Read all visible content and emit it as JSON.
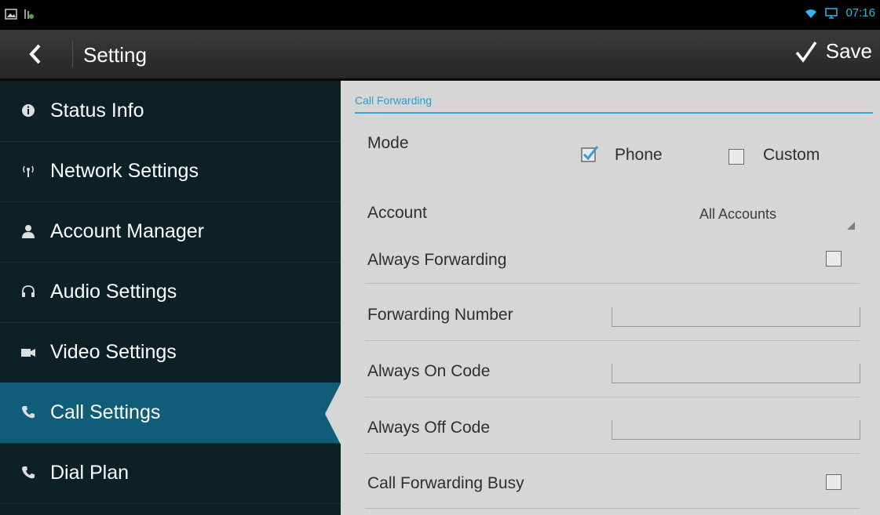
{
  "status_bar": {
    "time": "07:16",
    "left_icons": [
      "image-icon",
      "usb-icon"
    ],
    "right_icons": [
      "wifi-icon",
      "monitor-icon"
    ]
  },
  "action_bar": {
    "title": "Setting",
    "save_label": "Save"
  },
  "sidebar": {
    "items": [
      {
        "label": "Status Info",
        "icon": "info-icon",
        "active": false
      },
      {
        "label": "Network Settings",
        "icon": "antenna-icon",
        "active": false
      },
      {
        "label": "Account Manager",
        "icon": "person-icon",
        "active": false
      },
      {
        "label": "Audio Settings",
        "icon": "headset-icon",
        "active": false
      },
      {
        "label": "Video Settings",
        "icon": "camera-icon",
        "active": false
      },
      {
        "label": "Call Settings",
        "icon": "phone-icon",
        "active": true
      },
      {
        "label": "Dial Plan",
        "icon": "phone-icon",
        "active": false
      }
    ]
  },
  "content": {
    "section_title": "Call Forwarding",
    "mode_label": "Mode",
    "mode_options": [
      {
        "label": "Phone",
        "checked": true
      },
      {
        "label": "Custom",
        "checked": false
      }
    ],
    "account_label": "Account",
    "account_value": "All Accounts",
    "rows": [
      {
        "label": "Always Forwarding",
        "type": "checkbox",
        "checked": false
      },
      {
        "label": "Forwarding Number",
        "type": "text",
        "value": ""
      },
      {
        "label": "Always On Code",
        "type": "text",
        "value": ""
      },
      {
        "label": "Always Off Code",
        "type": "text",
        "value": ""
      },
      {
        "label": "Call Forwarding Busy",
        "type": "checkbox",
        "checked": false
      }
    ]
  },
  "colors": {
    "accent": "#33b5e5",
    "sidebar_bg": "#0d2026",
    "active_item": "#0f5d78"
  }
}
